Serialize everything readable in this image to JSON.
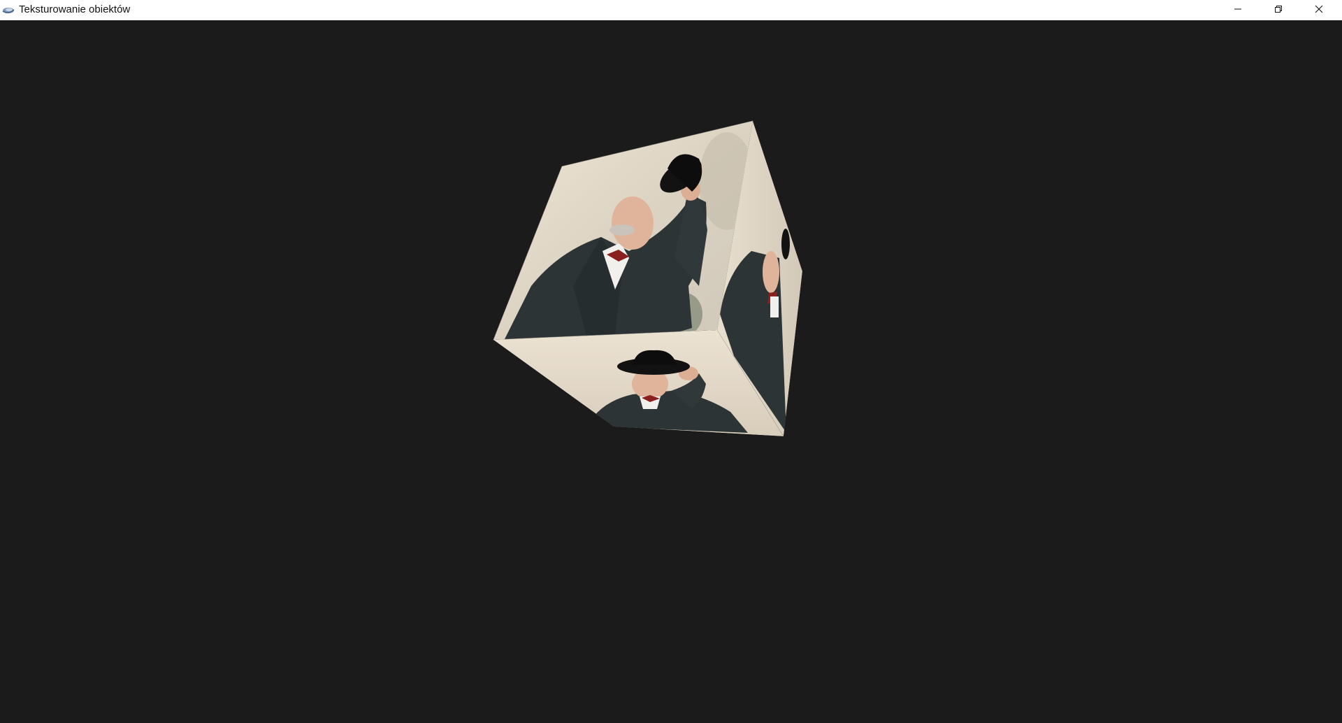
{
  "window": {
    "title": "Teksturowanie obiektów",
    "app_icon": "opengl-app-icon",
    "caption_buttons": [
      {
        "name": "minimize",
        "icon": "minimize-icon"
      },
      {
        "name": "restore",
        "icon": "restore-icon"
      },
      {
        "name": "close",
        "icon": "close-icon"
      }
    ]
  },
  "scene": {
    "background_color": "#1b1b1b",
    "object": "textured-cube",
    "texture": "portrait-man-with-hat-photo",
    "texture_colors": {
      "coat": "#2c3436",
      "background": "#e7dccb",
      "skin": "#e0b49a",
      "bowtie": "#8a1f1f",
      "hat": "#121212",
      "shirt": "#f2f0ec"
    }
  }
}
